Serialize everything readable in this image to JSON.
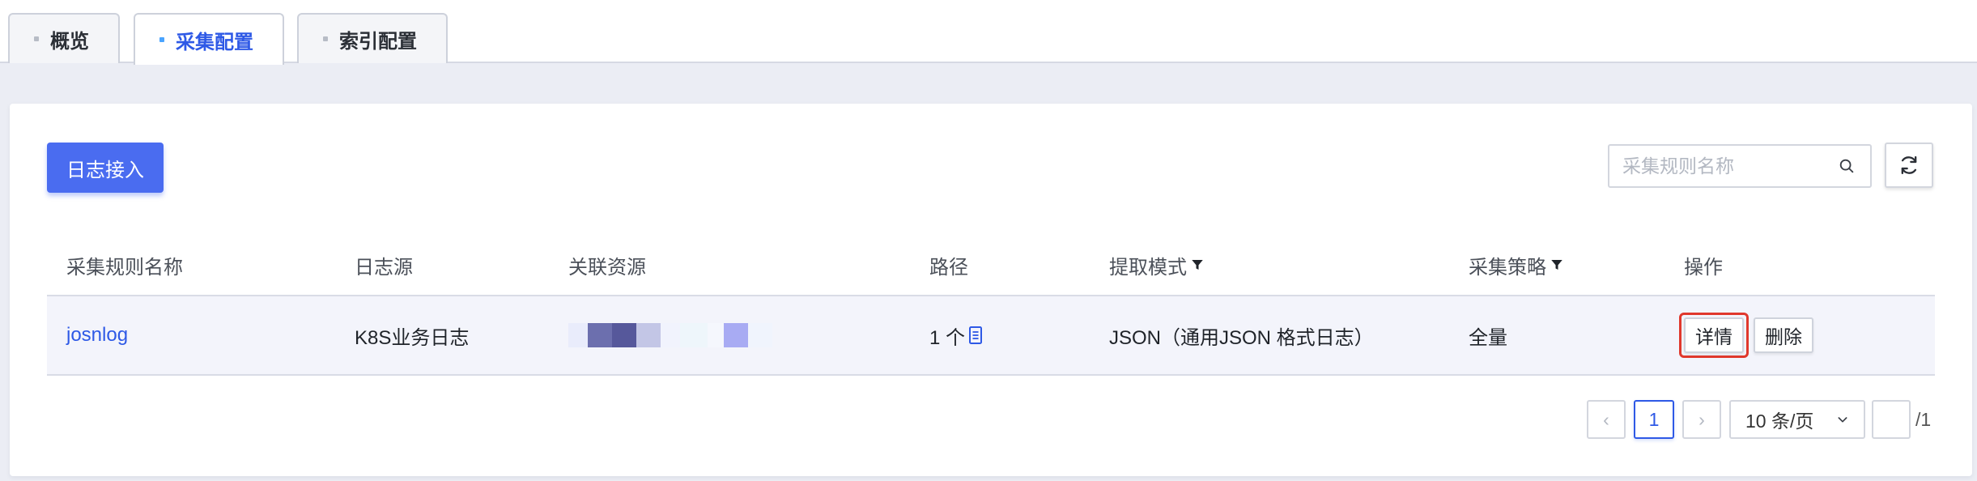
{
  "tabs": [
    {
      "label": "概览"
    },
    {
      "label": "采集配置"
    },
    {
      "label": "索引配置"
    }
  ],
  "toolbar": {
    "primary_button": "日志接入",
    "search_placeholder": "采集规则名称"
  },
  "table": {
    "headers": [
      "采集规则名称",
      "日志源",
      "关联资源",
      "路径",
      "提取模式",
      "采集策略",
      "操作"
    ],
    "rows": [
      {
        "name": "josnlog",
        "source": "K8S业务日志",
        "path_count": "1 个",
        "mode": "JSON（通用JSON 格式日志）",
        "policy": "全量",
        "detail_label": "详情",
        "delete_label": "删除"
      }
    ]
  },
  "pagination": {
    "prev": "‹",
    "current_page": "1",
    "next": "›",
    "page_size": "10 条/页",
    "jump_value": "",
    "total": "/1"
  },
  "colors": {
    "accent": "#4a6cf0",
    "link": "#2e59e6",
    "highlight": "#e0382c"
  }
}
